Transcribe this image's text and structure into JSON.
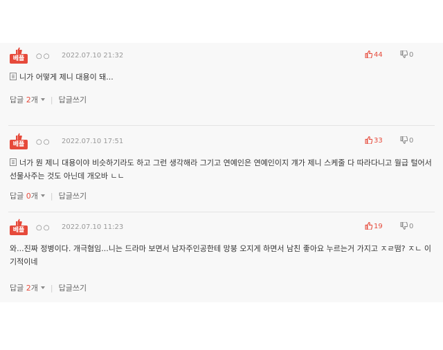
{
  "comments": [
    {
      "badge": "베플",
      "nickname": "○○",
      "date": "2022.07.10 21:32",
      "likes": "44",
      "dislikes": "0",
      "text": "니가 어떻게 제니 대용이 돼...",
      "reply_label": "답글",
      "reply_count": "2",
      "reply_unit": "개",
      "write_label": "답글쓰기"
    },
    {
      "badge": "베플",
      "nickname": "○○",
      "date": "2022.07.10 17:51",
      "likes": "33",
      "dislikes": "0",
      "text": "너가 뭔 제니 대용이야 비슷하기라도 하고 그런 생각해라 그기고 연예인은 연예인이지 걔가 제니 스케줄 다 따라다니고 월급 털어서 선물사주는 것도 아닌데 개오바 ㄴㄴ",
      "reply_label": "답글",
      "reply_count": "0",
      "reply_unit": "개",
      "write_label": "답글쓰기"
    },
    {
      "badge": "베플",
      "nickname": "○○",
      "date": "2022.07.10 11:23",
      "likes": "19",
      "dislikes": "0",
      "text": "와...진짜 정병이다. 개극혐임...니는 드라마 보면서 남자주인공한테 망붕 오지게 하면서 남친 좋아요 누르는거 가지고 ㅈㄹ떰? ㅈㄴ 이기적이네",
      "reply_label": "답글",
      "reply_count": "2",
      "reply_unit": "개",
      "write_label": "답글쓰기"
    }
  ],
  "colors": {
    "accent": "#e64a3b",
    "panel_bg": "#f8f8f8"
  },
  "icons": {
    "badge": "thumbs-up-icon",
    "like": "thumbs-up-icon",
    "dislike": "thumbs-down-icon",
    "body": "document-icon",
    "replies": "caret-down-icon"
  }
}
